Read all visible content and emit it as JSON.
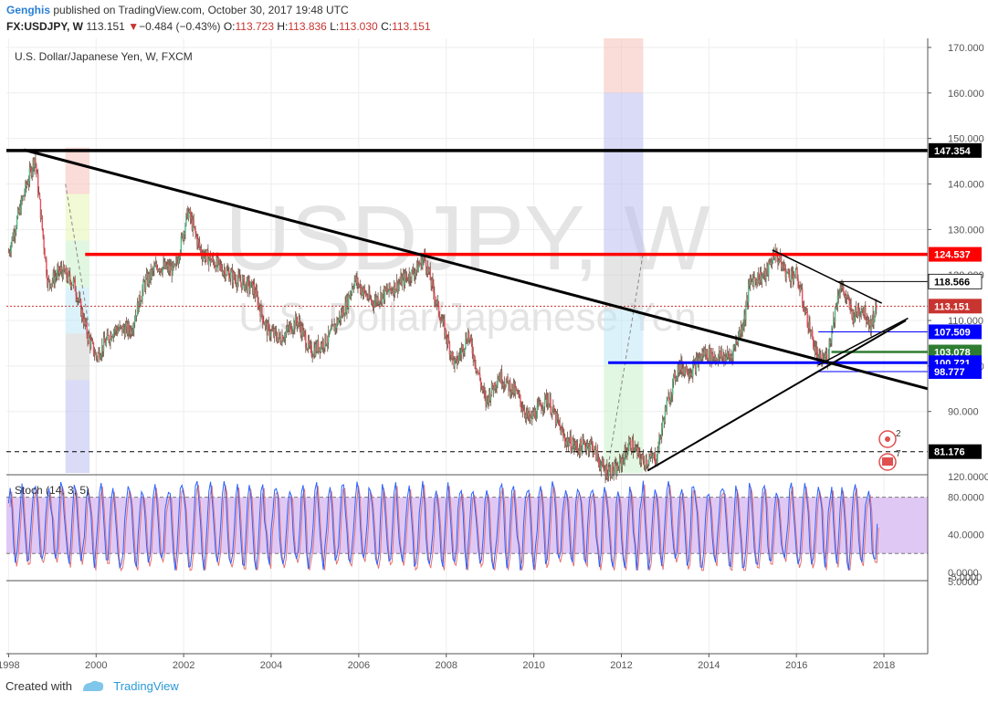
{
  "header": {
    "author": "Genghis",
    "published": "published on TradingView.com, October 30, 2017 19:48 UTC",
    "symbol": "FX:USDJPY, W",
    "last": "113.151",
    "arrow": "▼",
    "change": "−0.484 (−0.43%)",
    "o_label": "O:",
    "o_val": "113.723",
    "h_label": "H:",
    "h_val": "113.836",
    "l_label": "L:",
    "l_val": "113.030",
    "c_label": "C:",
    "c_val": "113.151"
  },
  "footer": {
    "created": "Created with",
    "brand": "TradingView"
  },
  "chart_data": [
    {
      "type": "candlestick",
      "title": "U.S. Dollar/Japanese Yen, W, FXCM",
      "watermark_symbol": "USDJPY, W",
      "watermark_name": "U.S. Dollar/Japanese Yen",
      "x_range": [
        1997.95,
        2019.0
      ],
      "y_range": [
        76.5,
        172.0
      ],
      "y_ticks": [
        90,
        100,
        110,
        120,
        130,
        140,
        150,
        160,
        170
      ],
      "y_tick_labels": [
        "90.000",
        "100.000",
        "110.000",
        "120.000",
        "130.000",
        "140.000",
        "150.000",
        "160.000",
        "170.000"
      ],
      "x_ticks": [
        1998,
        2000,
        2002,
        2004,
        2006,
        2008,
        2010,
        2012,
        2014,
        2016,
        2018
      ],
      "x_tick_labels": [
        "1998",
        "2000",
        "2002",
        "2004",
        "2006",
        "2008",
        "2010",
        "2012",
        "2014",
        "2016",
        "2018"
      ],
      "price_path": [
        [
          1998.0,
          125
        ],
        [
          1998.3,
          136
        ],
        [
          1998.6,
          146
        ],
        [
          1998.9,
          118
        ],
        [
          1999.2,
          121
        ],
        [
          1999.5,
          118
        ],
        [
          1999.8,
          107
        ],
        [
          2000.0,
          102
        ],
        [
          2000.4,
          108
        ],
        [
          2000.8,
          108
        ],
        [
          2001.1,
          118
        ],
        [
          2001.4,
          122
        ],
        [
          2001.8,
          121
        ],
        [
          2002.1,
          134
        ],
        [
          2002.4,
          125
        ],
        [
          2002.8,
          122
        ],
        [
          2003.2,
          119
        ],
        [
          2003.6,
          117
        ],
        [
          2003.9,
          108
        ],
        [
          2004.2,
          106
        ],
        [
          2004.6,
          110
        ],
        [
          2004.9,
          103
        ],
        [
          2005.3,
          106
        ],
        [
          2005.7,
          113
        ],
        [
          2005.9,
          119
        ],
        [
          2006.3,
          114
        ],
        [
          2006.6,
          116
        ],
        [
          2006.9,
          118
        ],
        [
          2007.3,
          121
        ],
        [
          2007.5,
          124
        ],
        [
          2007.8,
          113
        ],
        [
          2008.2,
          100
        ],
        [
          2008.5,
          107
        ],
        [
          2008.9,
          92
        ],
        [
          2009.2,
          98
        ],
        [
          2009.6,
          94
        ],
        [
          2009.9,
          88
        ],
        [
          2010.3,
          93
        ],
        [
          2010.7,
          84
        ],
        [
          2011.0,
          82
        ],
        [
          2011.3,
          83
        ],
        [
          2011.6,
          77
        ],
        [
          2011.9,
          77
        ],
        [
          2012.2,
          83
        ],
        [
          2012.5,
          79
        ],
        [
          2012.8,
          80
        ],
        [
          2013.0,
          90
        ],
        [
          2013.3,
          100
        ],
        [
          2013.6,
          99
        ],
        [
          2013.9,
          103
        ],
        [
          2014.1,
          102
        ],
        [
          2014.5,
          102
        ],
        [
          2014.8,
          110
        ],
        [
          2014.95,
          119
        ],
        [
          2015.3,
          120
        ],
        [
          2015.5,
          125
        ],
        [
          2015.8,
          120
        ],
        [
          2016.0,
          120
        ],
        [
          2016.2,
          112
        ],
        [
          2016.5,
          101
        ],
        [
          2016.7,
          102
        ],
        [
          2016.9,
          113
        ],
        [
          2017.0,
          118
        ],
        [
          2017.3,
          111
        ],
        [
          2017.5,
          113
        ],
        [
          2017.7,
          109
        ],
        [
          2017.83,
          113
        ]
      ],
      "horizontal_levels": [
        {
          "value": 147.354,
          "label": "147.354",
          "color": "#000000"
        },
        {
          "value": 124.537,
          "label": "124.537",
          "color": "#ff0000"
        },
        {
          "value": 118.566,
          "label": "118.566",
          "color": "#000000"
        },
        {
          "value": 113.151,
          "label": "113.151",
          "color": "#c8342f"
        },
        {
          "value": 107.509,
          "label": "107.509",
          "color": "#0000ff"
        },
        {
          "value": 103.078,
          "label": "103.078",
          "color": "#2e7d32"
        },
        {
          "value": 100.721,
          "label": "100.721",
          "color": "#0000ff"
        },
        {
          "value": 98.777,
          "label": "98.777",
          "color": "#0000ff"
        },
        {
          "value": 81.176,
          "label": "81.176",
          "color": "#000000"
        }
      ],
      "trendlines": [
        [
          [
            1998.35,
            147.5
          ],
          [
            2019.0,
            95.0
          ]
        ],
        [
          [
            2012.6,
            77.0
          ],
          [
            2018.5,
            110.0
          ]
        ],
        [
          [
            2015.45,
            125.5
          ],
          [
            2017.95,
            113.8
          ]
        ],
        [
          [
            2016.5,
            100.2
          ],
          [
            2018.55,
            110.5
          ]
        ]
      ],
      "annotations": {
        "alerts": "2",
        "events": "7"
      },
      "grid": true,
      "legend": "none"
    },
    {
      "type": "line",
      "title": "Stoch (14, 3, 5)",
      "y_range": [
        -9,
        102
      ],
      "y_ticks": [
        -5,
        0,
        40,
        80
      ],
      "y_tick_labels": [
        "-5.0000",
        "0.0000",
        "40.0000",
        "80.0000"
      ],
      "extra_tick_labels": [
        "5.0000",
        "120.0000"
      ],
      "band": [
        20,
        80
      ],
      "band_color": "#e0c8f5",
      "series": [
        {
          "color": "#2962ff"
        },
        {
          "color": "#e57373"
        }
      ]
    }
  ]
}
